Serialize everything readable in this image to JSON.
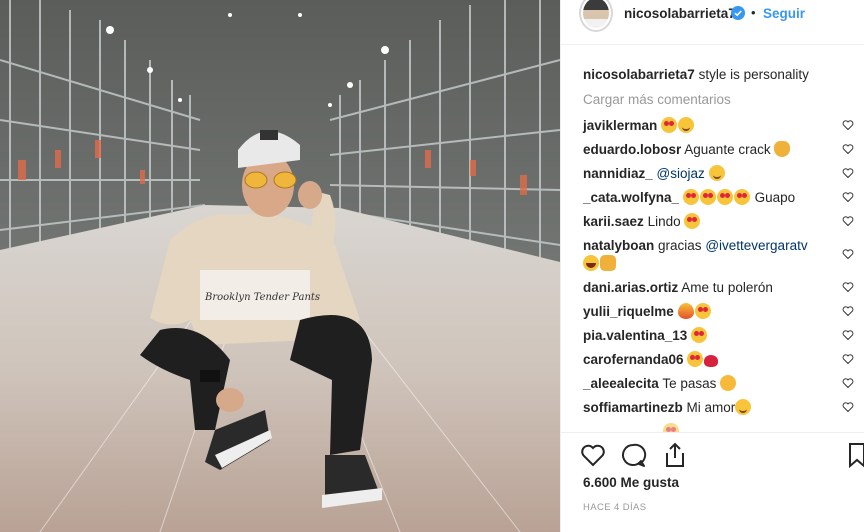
{
  "header": {
    "username": "nicosolabarrieta7",
    "separator": "•",
    "follow_label": "Seguir"
  },
  "caption": {
    "username": "nicosolabarrieta7",
    "text": "style is personality"
  },
  "load_more_label": "Cargar más comentarios",
  "comments": [
    {
      "username": "javiklerman",
      "text": "",
      "emojis": [
        "hearteyes",
        "smile"
      ]
    },
    {
      "username": "eduardo.lobosr",
      "text": "Aguante crack",
      "emojis": [
        "clap"
      ]
    },
    {
      "username": "nannidiaz_",
      "mention": "@siojaz",
      "text": "",
      "emojis": [
        "smile"
      ]
    },
    {
      "username": "_cata.wolfyna_",
      "text": "Guapo",
      "emojis": [
        "hearteyes",
        "hearteyes",
        "hearteyes",
        "hearteyes"
      ]
    },
    {
      "username": "karii.saez",
      "text": "Lindo",
      "emojis": [
        "hearteyes"
      ]
    },
    {
      "username": "natalyboan",
      "text": "gracias",
      "mention": "@ivettevergaratv",
      "emojis": [
        "laugh",
        "hands"
      ]
    },
    {
      "username": "dani.arias.ortiz",
      "text": "Ame tu polerón",
      "emojis": []
    },
    {
      "username": "yulii_riquelme",
      "text": "",
      "emojis": [
        "fire",
        "hearteyes"
      ]
    },
    {
      "username": "pia.valentina_13",
      "text": "",
      "emojis": [
        "hearteyes"
      ]
    },
    {
      "username": "carofernanda06",
      "text": "",
      "emojis": [
        "hearteyes",
        "redheart"
      ]
    },
    {
      "username": "_aleealecita",
      "text": "Te pasas",
      "emojis": [
        "cat"
      ]
    },
    {
      "username": "soffiamartinezb",
      "text": "Mi amor",
      "emojis": [
        "smile"
      ]
    }
  ],
  "likes_label": "6.600 Me gusta",
  "date_label": "HACE 4 DÍAS",
  "icons": {
    "like": "heart-outline-icon",
    "comment": "speech-bubble-icon",
    "share": "share-upload-icon",
    "verified": "verified-badge-icon",
    "comment_like": "small-heart-icon"
  },
  "colors": {
    "accent": "#3897f0",
    "text": "#262626",
    "muted": "#999999",
    "mention": "#003569"
  }
}
